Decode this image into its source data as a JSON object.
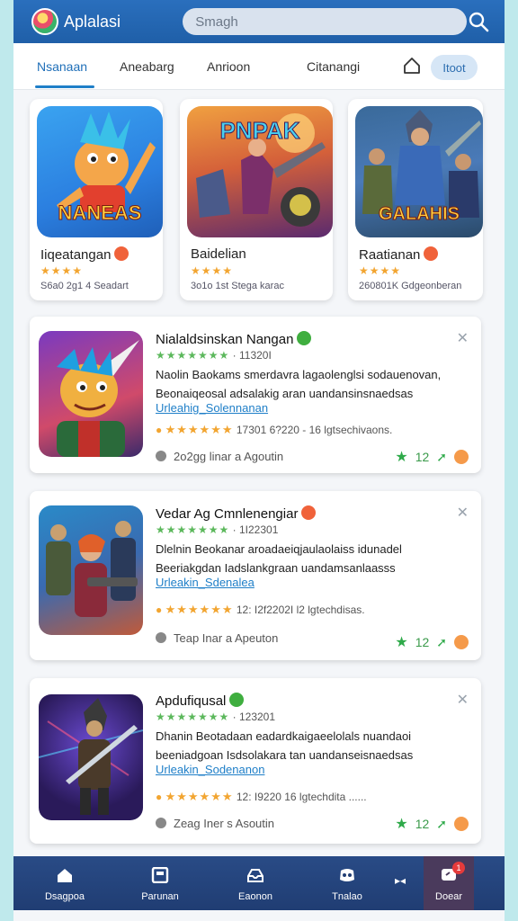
{
  "header": {
    "app_title": "Aplalasi",
    "search_placeholder": "Smagh"
  },
  "tabs": {
    "items": [
      {
        "label": "Nsanaan"
      },
      {
        "label": "Aneabarg"
      },
      {
        "label": "Anrioon"
      },
      {
        "label": "Citanangi"
      }
    ],
    "pill_label": "Itoot"
  },
  "featured": [
    {
      "art_text": "NANEAS",
      "title": "Iiqeatangan",
      "stars": "★★★★",
      "meta": "S6a0 2g1 4 Seadart",
      "badge_color": "#f0623a"
    },
    {
      "art_text": "PNPAK",
      "title": "Baidelian",
      "stars": "★★★★",
      "meta": "3o1o 1st Stega karac",
      "badge_color": ""
    },
    {
      "art_text": "GALAHIS",
      "title": "Raatianan",
      "stars": "★★★★",
      "meta": "260801K Gdgeonberan",
      "badge_color": "#f0623a"
    }
  ],
  "cards": [
    {
      "title": "Nialaldsinskan Nangan",
      "title_badge_color": "#3fae3f",
      "stars": "★★★★★★★",
      "rating_count": "11320I",
      "desc": "Naolin Baokams smerdavra lagaolenglsi sodauenovan, Beonaiqeosal adsalakig aran uandansinsnaedsas",
      "link": "Urleahig_Solennanan",
      "sub_stars": "★★★★★★",
      "sub_text": "17301 6?220 - 16 lgtsechivaons.",
      "author": "2o2gg linar a Agoutin",
      "count": "12"
    },
    {
      "title": "Vedar Ag Cmnlenengiar",
      "title_badge_color": "#f0623a",
      "stars": "★★★★★★★",
      "rating_count": "1I22301",
      "desc": "Dlelnin Beokanar aroadaeiqjaulaolaiss idunadel Beeriakgdan Iadslankgraan uandamsanlaasss",
      "link": "Urleakin_Sdenalea",
      "sub_stars": "★★★★★★",
      "sub_text": "12: I2f2202I l2 lgtechdisas.",
      "author": "Teap Inar a Apeuton",
      "count": "12"
    },
    {
      "title": "Apdufiqusal",
      "title_badge_color": "#3fae3f",
      "stars": "★★★★★★★",
      "rating_count": "123201",
      "desc": "Dhanin Beotadaan eadardkaigaeelolals nuandaoi beeniadgoan Isdsolakara tan uandanseisnaedsas",
      "link": "Urleakin_Sodenanon",
      "sub_stars": "★★★★★★",
      "sub_text": "12: I9220 16 lgtechdita ......",
      "author": "Zeag Iner s Asoutin",
      "count": "12"
    }
  ],
  "bottom_nav": [
    {
      "label": "Dsagpoa"
    },
    {
      "label": "Parunan"
    },
    {
      "label": "Eaonon"
    },
    {
      "label": "Tnalao"
    },
    {
      "label": "Doear"
    }
  ],
  "notif_count": "1",
  "colors": {
    "brand": "#1f5fa8",
    "accent": "#1f7fc8",
    "star_green": "#5cb85c",
    "star_gold": "#f2a531",
    "nav_bg": "#203d73"
  }
}
